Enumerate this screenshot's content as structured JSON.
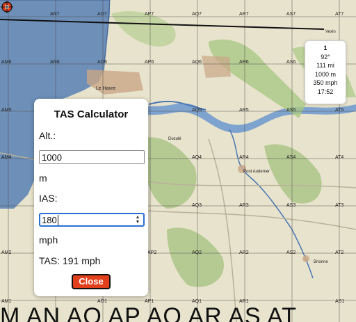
{
  "map": {
    "grid_labels_top": [
      "AN7",
      "AO7",
      "AP7",
      "AQ7",
      "AR7",
      "AS7",
      "AT7"
    ],
    "grid_labels_row6": [
      "AM6",
      "AN6",
      "AO6",
      "AP6",
      "AQ6",
      "AR6",
      "AS6"
    ],
    "grid_labels_row5": [
      "AM5",
      "AQ5",
      "AR5",
      "AS5",
      "AT5"
    ],
    "grid_labels_row4": [
      "AM4",
      "AQ4",
      "AR4",
      "AS4",
      "AT4"
    ],
    "grid_labels_row3": [
      "AQ3",
      "AR3",
      "AS3",
      "AT3"
    ],
    "grid_labels_row2": [
      "AM2",
      "AP2",
      "AQ2",
      "AR2",
      "AS2",
      "AT2"
    ],
    "grid_labels_bottom": [
      "AM1",
      "AO1",
      "AP1",
      "AQ1",
      "AR1",
      "AS1"
    ],
    "place_labels": [
      "Le Havre",
      "Pont Audemer",
      "Brionne",
      "Dozulé",
      "Vexin"
    ],
    "bottom_overlay_text": "M AN AO AP AQ AR AS AT"
  },
  "waypoint": {
    "number": "1",
    "heading": "92°",
    "distance": "111 mi",
    "altitude": "1000 m",
    "speed": "350 mph",
    "time": "17:52"
  },
  "tas_calculator": {
    "title": "TAS Calculator",
    "alt_label": "Alt.:",
    "alt_value": "1000",
    "alt_unit": "m",
    "ias_label": "IAS:",
    "ias_value": "180",
    "ias_unit": "mph",
    "result": "TAS: 191 mph",
    "close_label": "Close"
  },
  "colors": {
    "sea": "#6d8fb8",
    "land": "#e8e3cc",
    "forest": "#9fbf7a",
    "river": "#4a76b5",
    "close_button": "#e2401c",
    "focus_ring": "#2a6fd6"
  }
}
